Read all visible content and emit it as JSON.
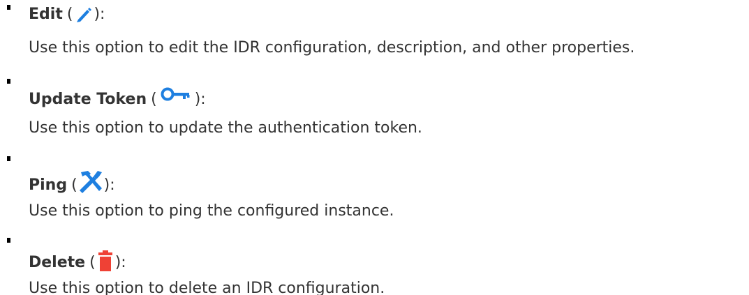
{
  "items": [
    {
      "name": "Edit",
      "icon": "pencil-icon",
      "open_paren": "(",
      "close_paren": "):",
      "description": "Use this option to edit the IDR configuration, description, and other properties."
    },
    {
      "name": "Update Token",
      "icon": "key-icon",
      "open_paren": "(",
      "close_paren": "):",
      "description": "Use this option to update the authentication token."
    },
    {
      "name": "Ping",
      "icon": "tools-icon",
      "open_paren": "(",
      "close_paren": "):",
      "description": "Use this option to ping the configured instance."
    },
    {
      "name": "Delete",
      "icon": "trash-icon",
      "open_paren": "(",
      "close_paren": "):",
      "description": "Use this option to delete an IDR configuration."
    }
  ],
  "colors": {
    "text": "#333333",
    "icon_blue": "#1e7fe0",
    "icon_red": "#ef4135",
    "bullet": "#000000"
  }
}
